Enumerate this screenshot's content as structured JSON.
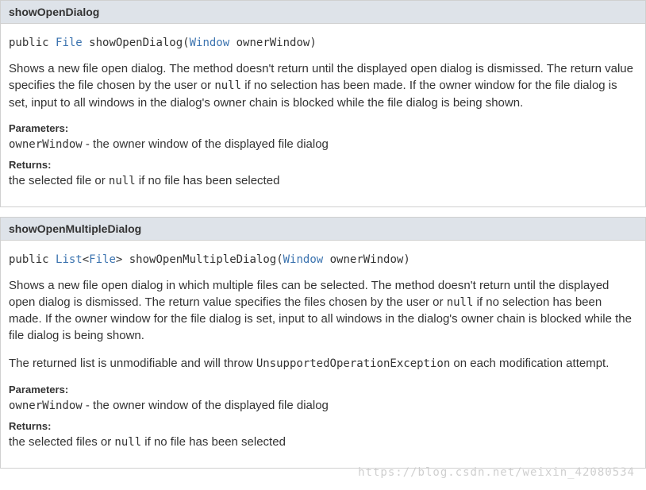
{
  "methods": [
    {
      "name": "showOpenDialog",
      "sig_prefix": "public ",
      "sig_return_type": "File",
      "sig_mid": " showOpenDialog(",
      "sig_param_type": "Window",
      "sig_suffix": " ownerWindow)",
      "desc_before": "Shows a new file open dialog. The method doesn't return until the displayed open dialog is dismissed. The return value specifies the file chosen by the user or ",
      "desc_code": "null",
      "desc_after": " if no selection has been made. If the owner window for the file dialog is set, input to all windows in the dialog's owner chain is blocked while the file dialog is being shown.",
      "params_label": "Parameters:",
      "param_name": "ownerWindow",
      "param_desc": " - the owner window of the displayed file dialog",
      "returns_label": "Returns:",
      "returns_before": "the selected file or ",
      "returns_code": "null",
      "returns_after": " if no file has been selected"
    },
    {
      "name": "showOpenMultipleDialog",
      "sig_prefix": "public ",
      "sig_return_type_1": "List",
      "sig_generic_open": "<",
      "sig_return_type_2": "File",
      "sig_generic_close": ">",
      "sig_mid": " showOpenMultipleDialog(",
      "sig_param_type": "Window",
      "sig_suffix": " ownerWindow)",
      "desc_before": "Shows a new file open dialog in which multiple files can be selected. The method doesn't return until the displayed open dialog is dismissed. The return value specifies the files chosen by the user or ",
      "desc_code": "null",
      "desc_after": " if no selection has been made. If the owner window for the file dialog is set, input to all windows in the dialog's owner chain is blocked while the file dialog is being shown.",
      "desc2_before": "The returned list is unmodifiable and will throw ",
      "desc2_code": "UnsupportedOperationException",
      "desc2_after": " on each modification attempt.",
      "params_label": "Parameters:",
      "param_name": "ownerWindow",
      "param_desc": " - the owner window of the displayed file dialog",
      "returns_label": "Returns:",
      "returns_before": "the selected files or ",
      "returns_code": "null",
      "returns_after": " if no file has been selected"
    }
  ],
  "watermark": "https://blog.csdn.net/weixin_42080534"
}
